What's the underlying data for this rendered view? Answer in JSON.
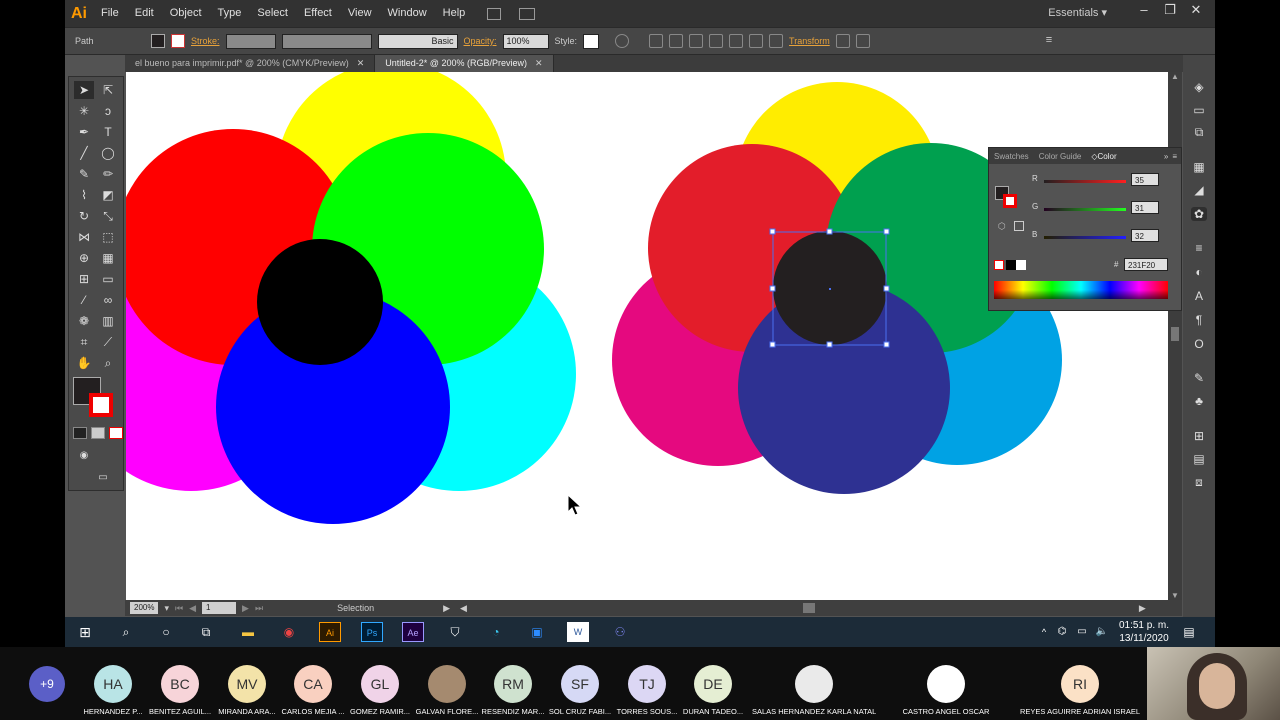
{
  "app": {
    "logo": "Ai",
    "menus": [
      "File",
      "Edit",
      "Object",
      "Type",
      "Select",
      "Effect",
      "View",
      "Window",
      "Help"
    ],
    "workspace": "Essentials",
    "window_controls": [
      "–",
      "❐",
      "✕"
    ]
  },
  "control_bar": {
    "selection_type": "Path",
    "stroke_label": "Stroke:",
    "brush_preset": "Basic",
    "opacity_label": "Opacity:",
    "opacity_value": "100%",
    "style_label": "Style:",
    "transform_label": "Transform"
  },
  "tabs": [
    {
      "label": "el bueno para imprimir.pdf* @ 200% (CMYK/Preview)",
      "active": false
    },
    {
      "label": "Untitled-2* @ 200% (RGB/Preview)",
      "active": true
    }
  ],
  "status_bar": {
    "zoom": "200%",
    "artboard": "1",
    "tool": "Selection"
  },
  "color_panel": {
    "tabs": [
      "Swatches",
      "Color Guide",
      "Color"
    ],
    "active_tab": "Color",
    "r_label": "R",
    "r_value": "35",
    "g_label": "G",
    "g_value": "31",
    "b_label": "B",
    "b_value": "32",
    "hex_label": "#",
    "hex_value": "231F20"
  },
  "artwork_colors": {
    "left": [
      "#ffff00",
      "#ff0000",
      "#00ff00",
      "#ff00ff",
      "#00ffff",
      "#0000ff",
      "#000000"
    ],
    "right": [
      "#ffed00",
      "#e31d2a",
      "#00a04f",
      "#e5097f",
      "#00a2e4",
      "#2e3192",
      "#231f20"
    ]
  },
  "taskbar": {
    "time": "01:51 p. m.",
    "date": "13/11/2020"
  },
  "meeting": {
    "extra_count": "+9",
    "participants": [
      {
        "initials": "HA",
        "name": "HERNANDEZ P...",
        "color": "#b9e4e6"
      },
      {
        "initials": "BC",
        "name": "BENITEZ AGUIL...",
        "color": "#f7d4d9"
      },
      {
        "initials": "MV",
        "name": "MIRANDA ARA...",
        "color": "#f3e3a9"
      },
      {
        "initials": "CA",
        "name": "CARLOS MEJIA ...",
        "color": "#f9d0c0"
      },
      {
        "initials": "GL",
        "name": "GOMEZ RAMIR...",
        "color": "#f0d3e8"
      },
      {
        "initials": "",
        "name": "GALVAN FLORE...",
        "color": "#a58a6f"
      },
      {
        "initials": "RM",
        "name": "RESENDIZ MAR...",
        "color": "#cfe2cf"
      },
      {
        "initials": "SF",
        "name": "SOL CRUZ FABI...",
        "color": "#d6d9f5"
      },
      {
        "initials": "TJ",
        "name": "TORRES SOUS...",
        "color": "#dcd7f4"
      },
      {
        "initials": "DE",
        "name": "DURAN TADEO...",
        "color": "#e5eed3"
      }
    ],
    "speakers": [
      {
        "initials": "",
        "name": "SALAS HERNANDEZ KARLA NATALIA",
        "color": "#eaeaea"
      },
      {
        "initials": "",
        "name": "CASTRO ANGEL OSCAR",
        "color": "#ffffff"
      },
      {
        "initials": "RI",
        "name": "REYES AGUIRRE ADRIAN ISRAEL",
        "color": "#fbe1c6"
      }
    ]
  }
}
